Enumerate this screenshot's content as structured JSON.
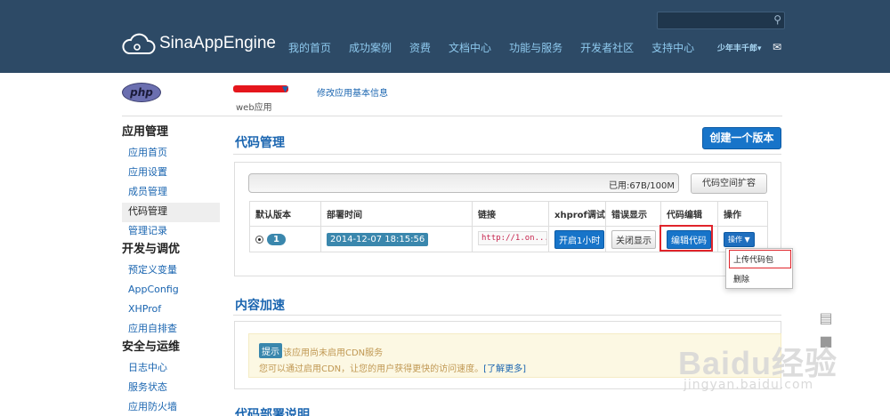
{
  "header": {
    "logo": "SinaAppEngine",
    "search_placeholder": "",
    "nav": [
      "我的首页",
      "成功案例",
      "资费",
      "文档中心",
      "功能与服务",
      "开发者社区",
      "支持中心"
    ],
    "user": "少年丰千郎",
    "icons": {
      "search": "search-icon",
      "mail": "mail-icon",
      "logo": "cloud-gear-icon"
    }
  },
  "app": {
    "badge": "php",
    "type": "web应用",
    "edit_info": "修改应用基本信息"
  },
  "sidebar": [
    {
      "label": "应用管理",
      "kind": "category"
    },
    {
      "label": "应用首页",
      "kind": "item"
    },
    {
      "label": "应用设置",
      "kind": "item"
    },
    {
      "label": "成员管理",
      "kind": "item"
    },
    {
      "label": "代码管理",
      "kind": "item",
      "active": true
    },
    {
      "label": "管理记录",
      "kind": "item"
    },
    {
      "label": "开发与调优",
      "kind": "category"
    },
    {
      "label": "预定义变量",
      "kind": "item"
    },
    {
      "label": "AppConfig",
      "kind": "item"
    },
    {
      "label": "XHProf",
      "kind": "item"
    },
    {
      "label": "应用自排查",
      "kind": "item"
    },
    {
      "label": "安全与运维",
      "kind": "category"
    },
    {
      "label": "日志中心",
      "kind": "item"
    },
    {
      "label": "服务状态",
      "kind": "item"
    },
    {
      "label": "应用防火墙",
      "kind": "item"
    }
  ],
  "code": {
    "title": "代码管理",
    "create_btn": "创建一个版本",
    "usage": "已用:67B/100M",
    "expand_btn": "代码空间扩容",
    "columns": [
      "默认版本",
      "部署时间",
      "链接",
      "xhprof调试",
      "错误显示",
      "代码编辑",
      "操作"
    ],
    "row": {
      "version": "1",
      "time": "2014-12-07 18:15:56",
      "link": "http://1.on...",
      "xhprof": "开启1小时",
      "errors": "关闭显示",
      "edit": "编辑代码",
      "action": "操作"
    },
    "dropdown": [
      "上传代码包",
      "删除"
    ]
  },
  "cdn": {
    "title": "内容加速",
    "tip": "提示",
    "line1": "该应用尚未启用CDN服务",
    "line2": "您可以通过启用CDN，让您的用户获得更快的访问速度。",
    "more": "[了解更多]"
  },
  "deploy": {
    "title": "代码部署说明"
  },
  "watermark": {
    "text": "Baidu经验",
    "sub": "jingyan.baidu.com"
  },
  "colors": {
    "header_bg": "#2d4a66",
    "nav_link": "#8ec9ee",
    "primary": "#1774c9",
    "highlight": "#e0242b"
  }
}
